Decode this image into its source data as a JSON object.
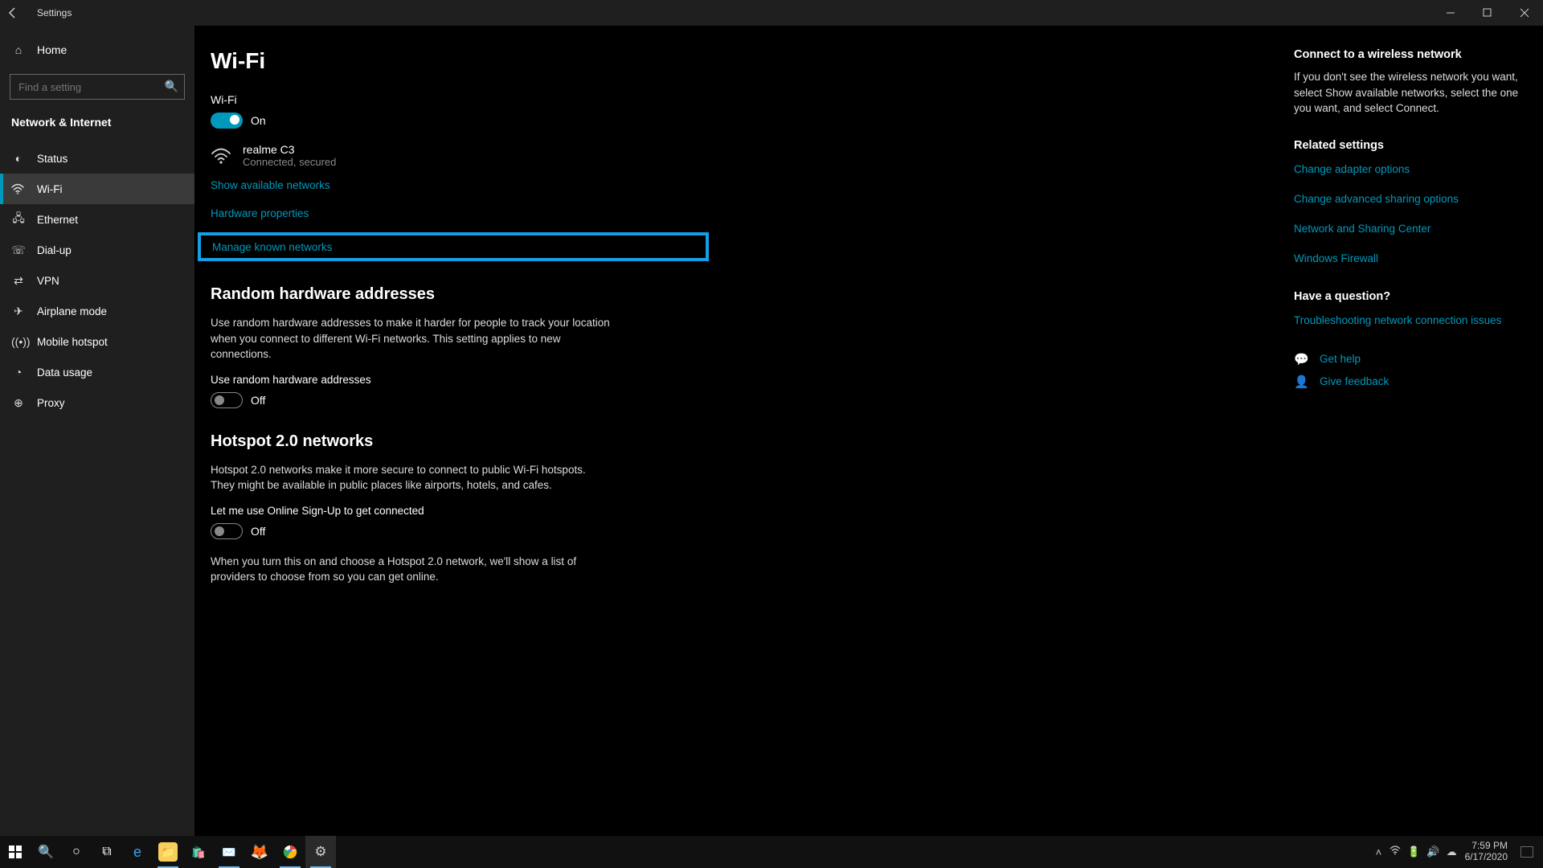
{
  "titlebar": {
    "title": "Settings"
  },
  "sidebar": {
    "home": "Home",
    "search_placeholder": "Find a setting",
    "category": "Network & Internet",
    "items": [
      {
        "icon": "status",
        "label": "Status"
      },
      {
        "icon": "wifi",
        "label": "Wi-Fi",
        "active": true
      },
      {
        "icon": "ethernet",
        "label": "Ethernet"
      },
      {
        "icon": "dialup",
        "label": "Dial-up"
      },
      {
        "icon": "vpn",
        "label": "VPN"
      },
      {
        "icon": "airplane",
        "label": "Airplane mode"
      },
      {
        "icon": "hotspot",
        "label": "Mobile hotspot"
      },
      {
        "icon": "datausage",
        "label": "Data usage"
      },
      {
        "icon": "proxy",
        "label": "Proxy"
      }
    ]
  },
  "main": {
    "title": "Wi-Fi",
    "wifi_label": "Wi-Fi",
    "wifi_state": "On",
    "network_name": "realme C3",
    "network_status": "Connected, secured",
    "links": {
      "show_networks": "Show available networks",
      "hardware_properties": "Hardware properties",
      "manage_known": "Manage known networks"
    },
    "random_title": "Random hardware addresses",
    "random_desc": "Use random hardware addresses to make it harder for people to track your location when you connect to different Wi-Fi networks. This setting applies to new connections.",
    "random_label": "Use random hardware addresses",
    "random_state": "Off",
    "hotspot_title": "Hotspot 2.0 networks",
    "hotspot_desc": "Hotspot 2.0 networks make it more secure to connect to public Wi-Fi hotspots. They might be available in public places like airports, hotels, and cafes.",
    "hotspot_label": "Let me use Online Sign-Up to get connected",
    "hotspot_state": "Off",
    "hotspot_footer": "When you turn this on and choose a Hotspot 2.0 network, we'll show a list of providers to choose from so you can get online."
  },
  "right": {
    "connect_title": "Connect to a wireless network",
    "connect_desc": "If you don't see the wireless network you want, select Show available networks, select the one you want, and select Connect.",
    "related_title": "Related settings",
    "related_links": [
      "Change adapter options",
      "Change advanced sharing options",
      "Network and Sharing Center",
      "Windows Firewall"
    ],
    "question_title": "Have a question?",
    "question_links": [
      "Troubleshooting network connection issues"
    ],
    "support": {
      "get_help": "Get help",
      "feedback": "Give feedback"
    }
  },
  "taskbar": {
    "time": "7:59 PM",
    "date": "6/17/2020"
  }
}
